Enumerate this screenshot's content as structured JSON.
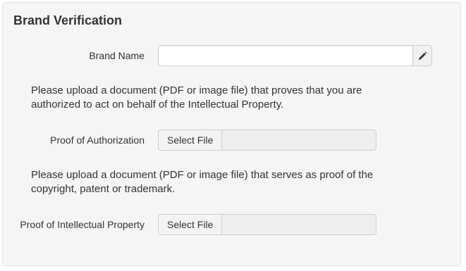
{
  "form": {
    "title": "Brand Verification",
    "brand_name": {
      "label": "Brand Name",
      "value": "",
      "placeholder": "",
      "edit_icon": "pencil-icon"
    },
    "authorization_instructions": "Please upload a document (PDF or image file) that proves that you are authorized to act on behalf of the Intellectual Property.",
    "proof_of_authorization": {
      "label": "Proof of Authorization",
      "button_label": "Select File",
      "file_name": ""
    },
    "ip_instructions": "Please upload a document (PDF or image file) that serves as proof of the copyright, patent or trademark.",
    "proof_of_ip": {
      "label": "Proof of Intellectual Property",
      "button_label": "Select File",
      "file_name": ""
    }
  },
  "colors": {
    "panel_background": "#f5f5f5",
    "panel_border": "#e3e3e3",
    "text": "#333333",
    "input_border": "#cccccc"
  }
}
